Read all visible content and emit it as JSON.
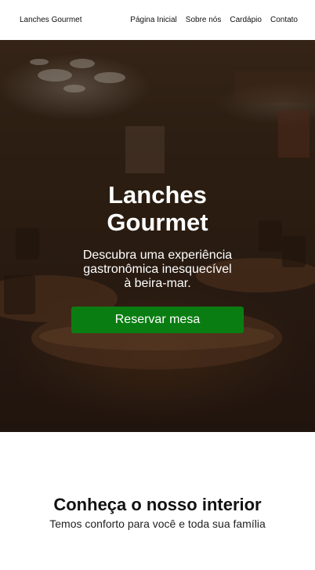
{
  "header": {
    "brand": "Lanches Gourmet",
    "nav": [
      "Página Inicial",
      "Sobre nós",
      "Cardápio",
      "Contato"
    ]
  },
  "hero": {
    "title": "Lanches Gourmet",
    "subtitle": "Descubra uma experiência gastronômica inesquecível à beira-mar.",
    "cta_label": "Reservar mesa",
    "cta_color": "#0a7d12"
  },
  "interior": {
    "title": "Conheça o nosso interior",
    "subtitle": "Temos conforto para você e toda sua família"
  }
}
